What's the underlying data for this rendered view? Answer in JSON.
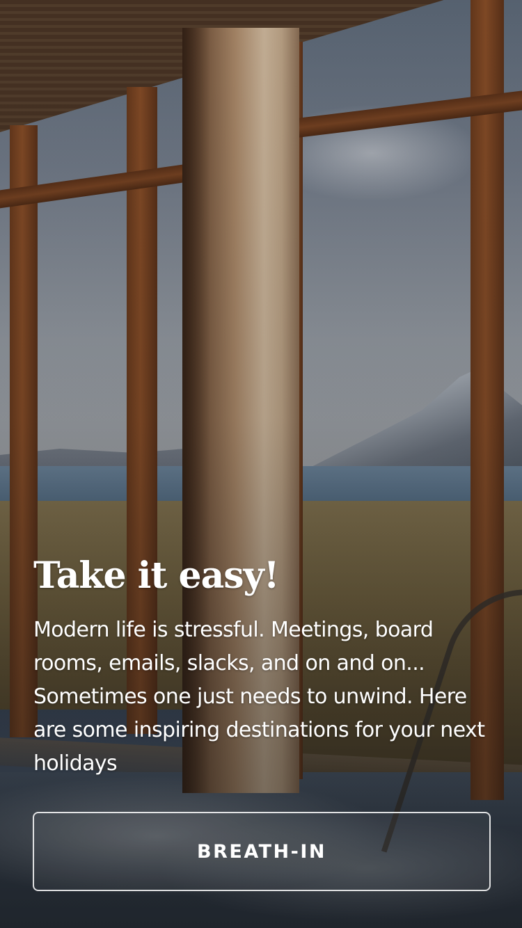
{
  "background": {
    "image": "window-view-patagonia-spa"
  },
  "hero": {
    "title": "Take it easy!",
    "description": "Modern life is stressful. Meetings, board rooms, emails, slacks, and on and on... Sometimes one just needs to unwind. Here are some inspiring destinations for your next holidays"
  },
  "cta": {
    "label": "BREATH-IN"
  },
  "colors": {
    "text": "#ffffff",
    "button_border": "#ffffff"
  }
}
